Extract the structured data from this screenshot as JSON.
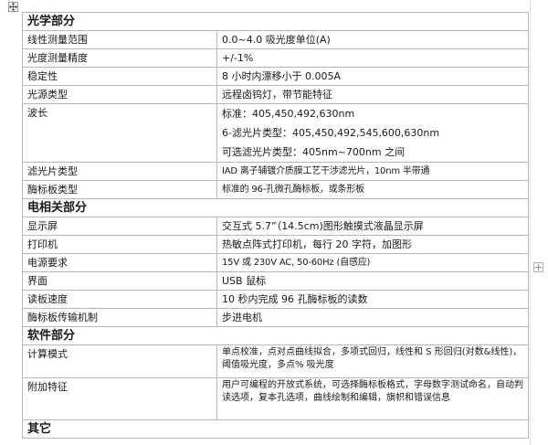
{
  "table": {
    "sections": [
      {
        "title": "光学部分",
        "rows": [
          {
            "name": "线性测量范围",
            "value": [
              "0.0~4.0 吸光度单位(A)"
            ]
          },
          {
            "name": "光度测量精度",
            "value": [
              "+/-1%"
            ]
          },
          {
            "name": "稳定性",
            "value": [
              "8 小时内漂移小于 0.005A"
            ]
          },
          {
            "name": "光源类型",
            "value": [
              "远程卤钨灯，带节能特征"
            ]
          },
          {
            "name": "波长",
            "value": [
              "标准：405,450,492,630nm",
              "6-滤光片类型：405,450,492,545,600,630nm",
              "可选滤光片类型：405nm~700nm 之间"
            ]
          },
          {
            "name": "滤光片类型",
            "value": [
              "IAD 离子辅镀介质膜工艺干涉滤光片，10nm 半带通"
            ]
          },
          {
            "name": "酶标板类型",
            "value": [
              "标准的 96-孔微孔酶标板，或条形板"
            ]
          }
        ]
      },
      {
        "title": "电相关部分",
        "rows": [
          {
            "name": "显示屏",
            "value": [
              "交互式 5.7”（14.5cm)图形触摸式液晶显示屏"
            ]
          },
          {
            "name": "打印机",
            "value": [
              "热敏点阵式打印机，每行 20 字符，加图形"
            ]
          },
          {
            "name": "电源要求",
            "value": [
              "15V 或 230V AC, 50-60Hz (自感应)"
            ]
          },
          {
            "name": "界面",
            "value": [
              "USB 鼠标"
            ]
          },
          {
            "name": "读板速度",
            "value": [
              "10 秒内完成 96 孔酶标板的读数"
            ]
          },
          {
            "name": "酶标板传输机制",
            "value": [
              "步进电机"
            ]
          }
        ]
      },
      {
        "title": "软件部分",
        "rows": [
          {
            "name": "计算模式",
            "value": [
              "单点校准，点对点曲线拟合，多项式回归，线性和 S 形回归(对数&线性)，阈值吸光度，多点% 吸光度"
            ]
          },
          {
            "name": "附加特征",
            "value": [
              "用户可编程的开放式系统，可选择酶标板格式，字母数字测试命名，自动判读选项，复本孔选项，曲线绘制和编辑，旗帜和错误信息"
            ]
          }
        ]
      },
      {
        "title": "其它",
        "rows": []
      }
    ]
  }
}
